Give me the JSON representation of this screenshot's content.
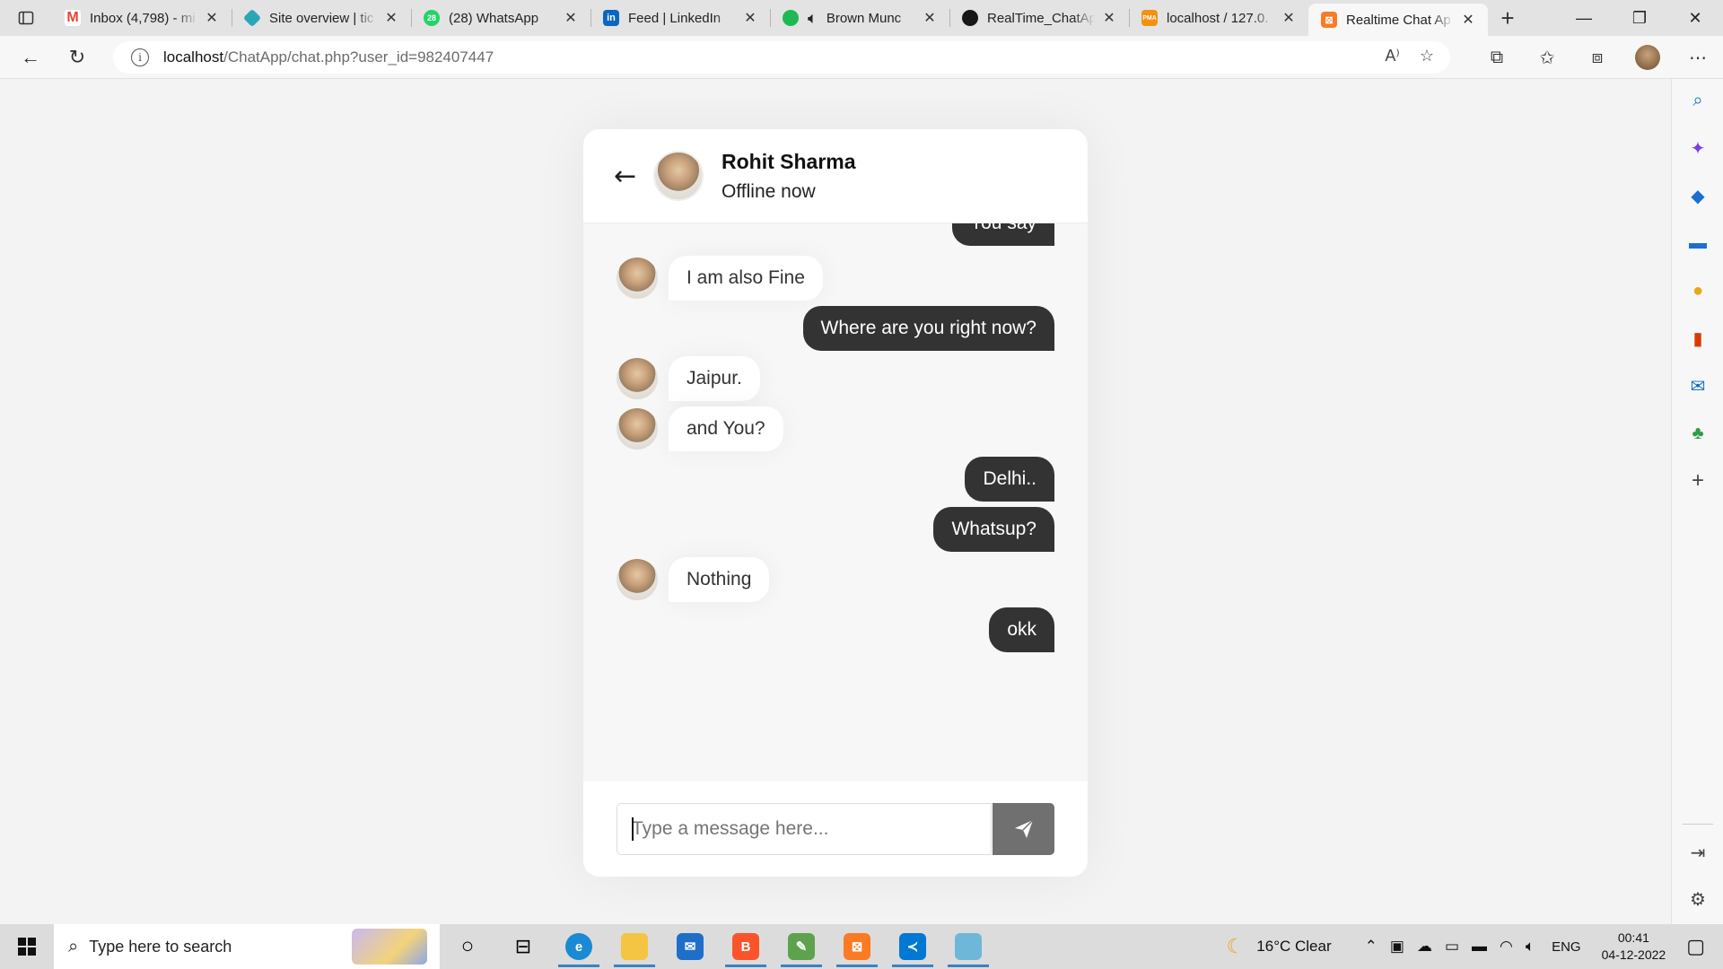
{
  "browser": {
    "tabs": [
      {
        "title": "Inbox (4,798) - mi",
        "icon": "gmail-icon",
        "color": "#EA4335"
      },
      {
        "title": "Site overview | tic",
        "icon": "diamond-icon",
        "color": "#2AA7B5"
      },
      {
        "title": "(28) WhatsApp",
        "icon": "whatsapp-icon",
        "color": "#25D366"
      },
      {
        "title": "Feed | LinkedIn",
        "icon": "linkedin-icon",
        "color": "#0A66C2"
      },
      {
        "title": "Brown Munc",
        "icon": "spotify-icon",
        "color": "#1DB954"
      },
      {
        "title": "RealTime_ChatAp",
        "icon": "github-icon",
        "color": "#181717"
      },
      {
        "title": "localhost / 127.0.",
        "icon": "phpmyadmin-icon",
        "color": "#F29111"
      },
      {
        "title": "Realtime Chat Ap",
        "icon": "xampp-icon",
        "color": "#FB7A24"
      }
    ],
    "active_tab": 7,
    "url_host": "localhost",
    "url_path": "/ChatApp/chat.php?user_id=982407447"
  },
  "chat": {
    "user_name": "Rohit Sharma",
    "user_status": "Offline now",
    "messages": [
      {
        "dir": "out",
        "text": "You say"
      },
      {
        "dir": "in",
        "text": "I am also Fine"
      },
      {
        "dir": "out",
        "text": "Where are you right now?"
      },
      {
        "dir": "in",
        "text": "Jaipur."
      },
      {
        "dir": "in",
        "text": "and You?"
      },
      {
        "dir": "out",
        "text": "Delhi.."
      },
      {
        "dir": "out",
        "text": "Whatsup?"
      },
      {
        "dir": "in",
        "text": "Nothing"
      },
      {
        "dir": "out",
        "text": "okk"
      }
    ],
    "input_placeholder": "Type a message here...",
    "send_icon": "paper-plane-icon"
  },
  "taskbar": {
    "search_placeholder": "Type here to search",
    "weather": "16°C  Clear",
    "language": "ENG",
    "time": "00:41",
    "date": "04-12-2022"
  }
}
